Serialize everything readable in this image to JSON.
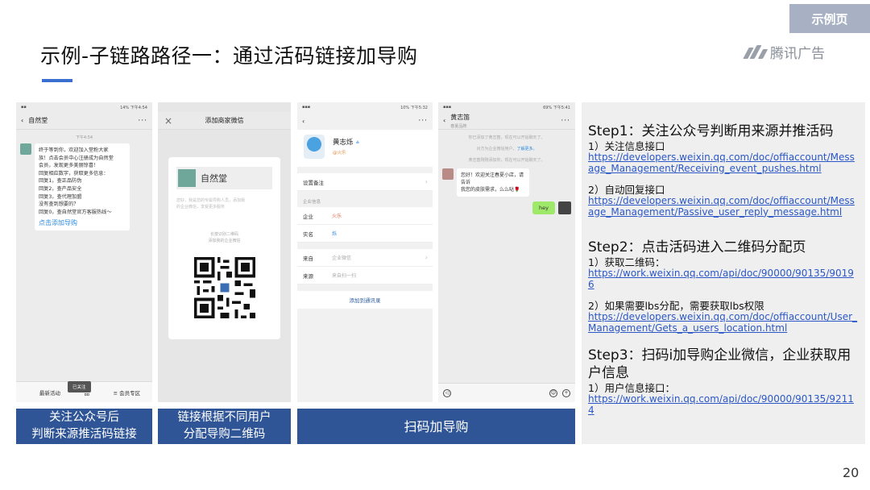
{
  "tag": "示例页",
  "title": "示例-子链路路径一：通过活码链接加导购",
  "brand": "腾讯广告",
  "phone1": {
    "time": "14% 下午4:54",
    "chat_name": "自然堂",
    "timestamp": "下午4:54",
    "msg_lines": [
      "终于等到你，欢迎加入堂粉大家",
      "族！点击会员中心注册成为自然堂",
      "会员，发现更多美丽惊喜！",
      "回复相应数字，获取更多信息：",
      "回复1，查正品防伪",
      "回复2，查产品安全",
      "回复3，查代理加盟",
      "没有查到想要的？",
      "回复0，查自然堂官方客服热线～"
    ],
    "msg_link": "点击添加导购",
    "menu": [
      "最新活动",
      "品",
      "≡ 会员专区"
    ],
    "toast": "已关注"
  },
  "phone2": {
    "nav_title": "添加商家微信",
    "card_name": "自然堂",
    "desc_line1": "您好，我是您的专属导购人员，添加我",
    "desc_line2": "的企业微信，享受更多服务",
    "hint_line1": "长按识别二维码",
    "hint_line2": "添加我的企业微信"
  },
  "phone3": {
    "time": "10% 下午5:32",
    "name": "黄志烁",
    "name_mark": "≗",
    "sub": "@火乐",
    "remark_label": "设置备注",
    "section_label": "企业信息",
    "rows": [
      {
        "label": "企业",
        "value": "火乐"
      },
      {
        "label": "实名",
        "value": "烁"
      }
    ],
    "rows2": [
      {
        "label": "来自",
        "value": "企业微信"
      },
      {
        "label": "来源",
        "value": "来自扫一扫"
      }
    ],
    "add_contact": "添加到通讯录"
  },
  "phone4": {
    "time": "69% 下午5:41",
    "chat_name": "黄志笛",
    "chat_sub": "春夏品牌",
    "sys1": "你已添加了黄志笛，现在可以开始聊天了。",
    "sys2_a": "对方为企业微信用户，",
    "sys2_b": "了解更多。",
    "sys3": "黄志笛刚刚添加你，现在可以开始聊天了。",
    "msg_lines": [
      "您好！欢迎关注春夏小店，请告诉",
      "我您的皮肤需求，么么哒🌹"
    ],
    "reply": "hey"
  },
  "captions": {
    "c1_line1": "关注公众号后",
    "c1_line2": "判断来源推活码链接",
    "c2_line1": "链接根据不同用户",
    "c2_line2": "分配导购二维码",
    "c3": "扫码加导购"
  },
  "steps": {
    "step1_title": "Step1：关注公众号判断用来源并推活码",
    "step1_sub1": "1）关注信息接口",
    "step1_url1": "https://developers.weixin.qq.com/doc/offiaccount/Message_Management/Receiving_event_pushes.html",
    "step1_sub2": "2）自动回复接口",
    "step1_url2": "https://developers.weixin.qq.com/doc/offiaccount/Message_Management/Passive_user_reply_message.html",
    "step2_title": "Step2：点击活码进入二维码分配页",
    "step2_sub1": "1）获取二维码：",
    "step2_url1": "https://work.weixin.qq.com/api/doc/90000/90135/90196",
    "step2_sub2": "2）如果需要lbs分配，需要获取lbs权限",
    "step2_url2": "https://developers.weixin.qq.com/doc/offiaccount/User_Management/Gets_a_users_location.html",
    "step3_title": "Step3：扫码i加导购企业微信，企业获取用户信息",
    "step3_sub1": "1）用户信息接口：",
    "step3_url1": "https://work.weixin.qq.com/api/doc/90000/90135/92114"
  },
  "page_number": "20",
  "colors": {
    "caption_bg": "#2f5597",
    "tag_bg": "#a7b1c3",
    "accent": "#3a6fd0",
    "link": "#2b58c6"
  }
}
